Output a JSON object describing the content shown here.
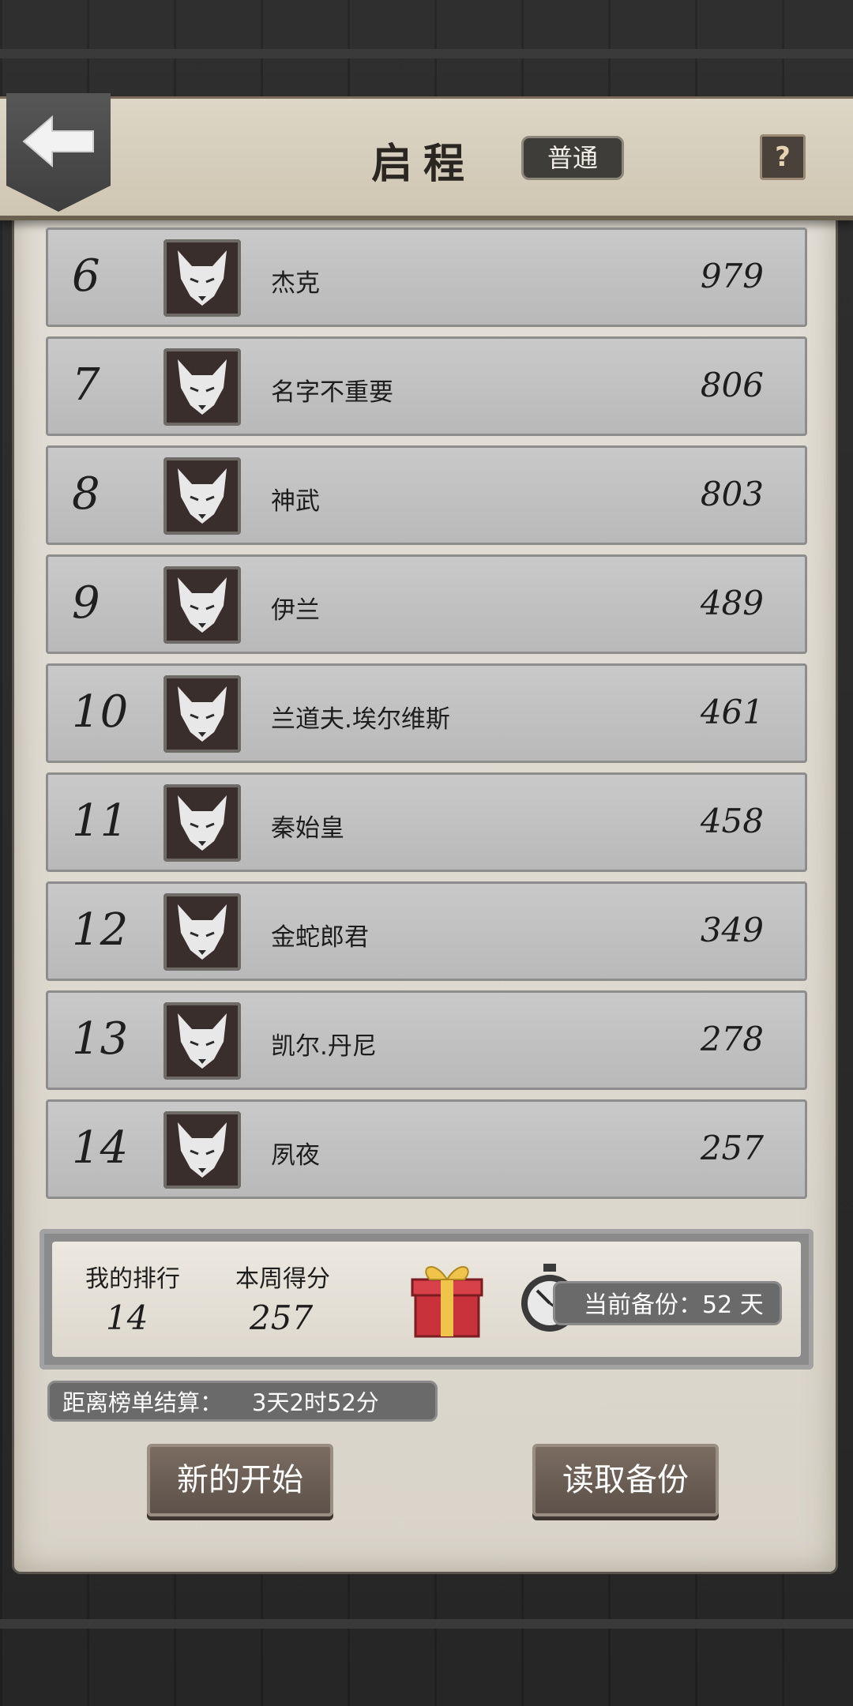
{
  "header": {
    "title": "启程",
    "mode": "普通",
    "help_label": "?"
  },
  "leaderboard": [
    {
      "rank": "6",
      "name": "杰克",
      "score": "979"
    },
    {
      "rank": "7",
      "name": "名字不重要",
      "score": "806"
    },
    {
      "rank": "8",
      "name": "神武",
      "score": "803"
    },
    {
      "rank": "9",
      "name": "伊兰",
      "score": "489"
    },
    {
      "rank": "10",
      "name": "兰道夫.埃尔维斯",
      "score": "461"
    },
    {
      "rank": "11",
      "name": "秦始皇",
      "score": "458"
    },
    {
      "rank": "12",
      "name": "金蛇郎君",
      "score": "349"
    },
    {
      "rank": "13",
      "name": "凯尔.丹尼",
      "score": "278"
    },
    {
      "rank": "14",
      "name": "夙夜",
      "score": "257"
    }
  ],
  "my_stats": {
    "rank_label": "我的排行",
    "rank_value": "14",
    "score_label": "本周得分",
    "score_value": "257",
    "backup_text": "当前备份：52 天"
  },
  "countdown": {
    "label": "距离榜单结算：",
    "value": "3天2时52分"
  },
  "buttons": {
    "new_start": "新的开始",
    "load_backup": "读取备份"
  },
  "icons": {
    "back": "back-arrow-icon",
    "avatar": "wolf-icon",
    "gift": "gift-icon",
    "stopwatch": "stopwatch-icon"
  }
}
